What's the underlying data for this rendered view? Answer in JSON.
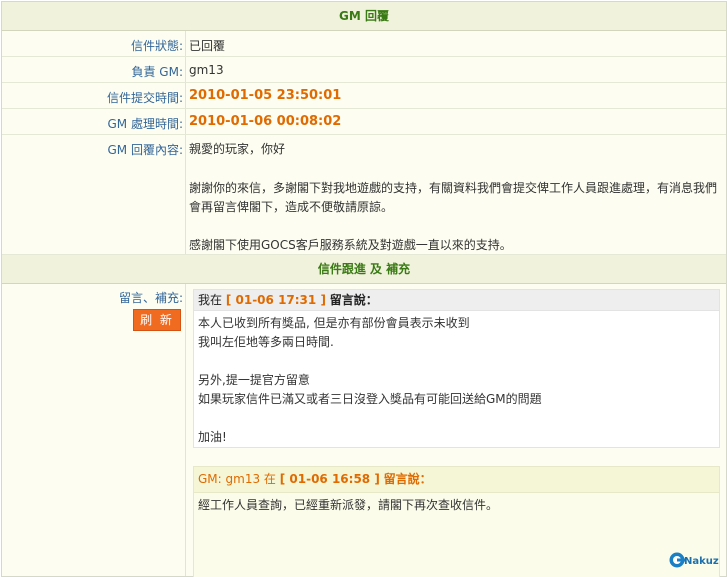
{
  "gm_reply": {
    "title": "GM 回覆",
    "fields": [
      {
        "label": "信件狀態:",
        "value": "已回覆"
      },
      {
        "label": "負責 GM:",
        "value": "gm13"
      },
      {
        "label": "信件提交時間:",
        "value": "2010-01-05 23:50:01"
      },
      {
        "label": "GM 處理時間:",
        "value": "2010-01-06 00:08:02"
      }
    ],
    "content_label": "GM 回覆內容:",
    "content": [
      "親愛的玩家，你好",
      "謝謝你的來信，多謝閣下對我地遊戲的支持，有關資料我們會提交俾工作人員跟進處理，有消息我們",
      "會再留言俾閣下，造成不便敬請原諒。",
      "感謝閣下使用GOCS客戶服務系統及對遊戲一直以來的支持。"
    ]
  },
  "followup": {
    "title": "信件跟進 及 補充",
    "label": "留言、補充:",
    "refresh_label": "刷 新",
    "messages": [
      {
        "prefix": "我在",
        "time": "[ 01-06 17:31 ]",
        "suffix": "留言說：",
        "lines": [
          "本人已收到所有獎品, 但是亦有部份會員表示未收到",
          "我叫左佢地等多兩日時間.",
          "",
          "另外,提一提官方留意",
          "如果玩家信件已滿又或者三日沒登入獎品有可能回送給GM的問題",
          "",
          "加油!"
        ]
      },
      {
        "prefix": "GM: gm13 在",
        "time": "[ 01-06 16:58 ]",
        "suffix": "留言說：",
        "lines": [
          "經工作人員查詢，已經重新派發，請閣下再次查收信件。"
        ]
      }
    ]
  },
  "watermark": "Nakuz",
  "colors": {
    "accent_orange": "#e06a00",
    "header_green": "#3a7a14",
    "label_blue": "#336699",
    "button": "#f06a20"
  }
}
